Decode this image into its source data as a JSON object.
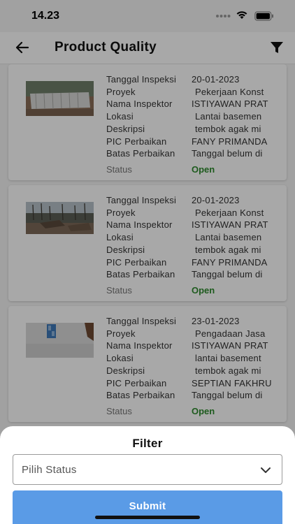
{
  "status_bar": {
    "time": "14.23"
  },
  "app_bar": {
    "title": "Product Quality"
  },
  "field_labels": [
    "Tanggal Inspeksi",
    "Proyek",
    "Nama Inspektor",
    "Lokasi",
    "Deskripsi",
    "PIC Perbaikan",
    "Batas Perbaikan"
  ],
  "status_label": "Status",
  "inspections": [
    {
      "values": [
        "20-01-2023",
        "Pekerjaan Konst",
        "ISTIYAWAN PRAT",
        "Lantai basemen",
        "tembok agak mi",
        "FANY PRIMANDA",
        "Tanggal belum di"
      ],
      "status": "Open"
    },
    {
      "values": [
        "20-01-2023",
        "Pekerjaan Konst",
        "ISTIYAWAN PRAT",
        "Lantai basemen",
        "tembok agak mi",
        "FANY PRIMANDA",
        "Tanggal belum di"
      ],
      "status": "Open"
    },
    {
      "values": [
        "23-01-2023",
        "Pengadaan Jasa",
        "ISTIYAWAN PRAT",
        "lantai basement",
        "tembok agak mi",
        "SEPTIAN FAKHRU",
        "Tanggal belum di"
      ],
      "status": "Open"
    }
  ],
  "filter_sheet": {
    "title": "Filter",
    "status_placeholder": "Pilih Status",
    "submit_label": "Submit"
  },
  "colors": {
    "status_open": "#2e8b2e",
    "submit": "#5a9be6"
  },
  "icons": [
    "back-arrow-icon",
    "filter-icon",
    "chevron-down-icon",
    "signal-icon",
    "wifi-icon",
    "battery-icon"
  ]
}
